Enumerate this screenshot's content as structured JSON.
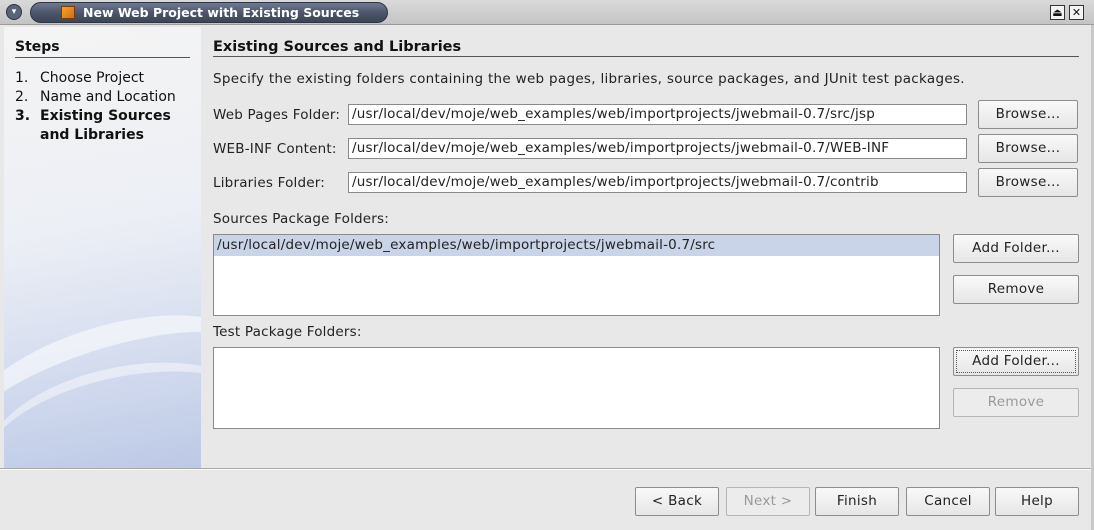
{
  "window": {
    "title": "New Web Project with Existing Sources",
    "menu_glyph": "▾",
    "maximize_glyph": "⏏",
    "close_glyph": "✕"
  },
  "steps": {
    "heading": "Steps",
    "items": [
      {
        "num": "1.",
        "label": "Choose Project"
      },
      {
        "num": "2.",
        "label": "Name and Location"
      },
      {
        "num": "3.",
        "label_line1": "Existing Sources",
        "label_line2": "and Libraries"
      }
    ]
  },
  "main": {
    "title": "Existing Sources and Libraries",
    "description": "Specify the existing folders containing the web pages, libraries, source packages, and JUnit test packages.",
    "web_pages": {
      "label": "Web Pages Folder:",
      "value": "/usr/local/dev/moje/web_examples/web/importprojects/jwebmail-0.7/src/jsp",
      "button": "Browse..."
    },
    "web_inf": {
      "label": "WEB-INF Content:",
      "value": "/usr/local/dev/moje/web_examples/web/importprojects/jwebmail-0.7/WEB-INF",
      "button": "Browse..."
    },
    "libraries": {
      "label": "Libraries Folder:",
      "value": "/usr/local/dev/moje/web_examples/web/importprojects/jwebmail-0.7/contrib",
      "button": "Browse..."
    },
    "sources": {
      "label": "Sources Package Folders:",
      "items": [
        "/usr/local/dev/moje/web_examples/web/importprojects/jwebmail-0.7/src"
      ],
      "add_button": "Add Folder...",
      "remove_button": "Remove"
    },
    "tests": {
      "label": "Test Package Folders:",
      "items": [],
      "add_button": "Add Folder...",
      "remove_button": "Remove"
    }
  },
  "footer": {
    "back": "< Back",
    "next": "Next >",
    "finish": "Finish",
    "cancel": "Cancel",
    "help": "Help"
  }
}
